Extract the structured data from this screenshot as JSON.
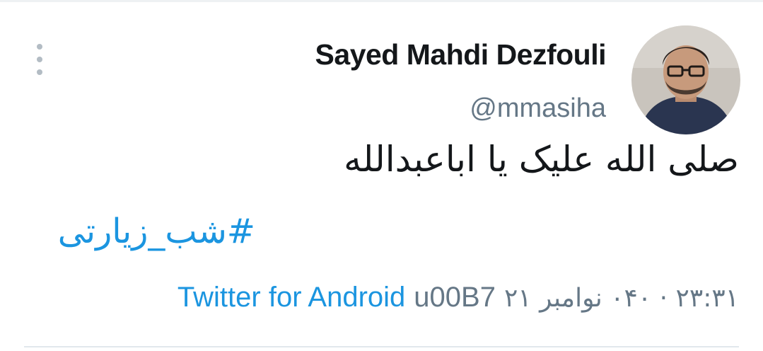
{
  "tweet": {
    "author_name": "Sayed Mahdi Dezfouli",
    "author_handle": "@mmasiha",
    "text": "صلی الله علیک یا اباعبدالله",
    "hashtag": "#شب_زیارتی",
    "source": "Twitter for Android",
    "separator": "u00B7",
    "datetime": "۲۳:۳۱ · ۰۴۰ نوامبر ۲۱"
  },
  "icons": {
    "menu": "more-vertical-icon"
  },
  "colors": {
    "link": "#1b95e0",
    "text": "#14171a",
    "secondary": "#657786"
  }
}
